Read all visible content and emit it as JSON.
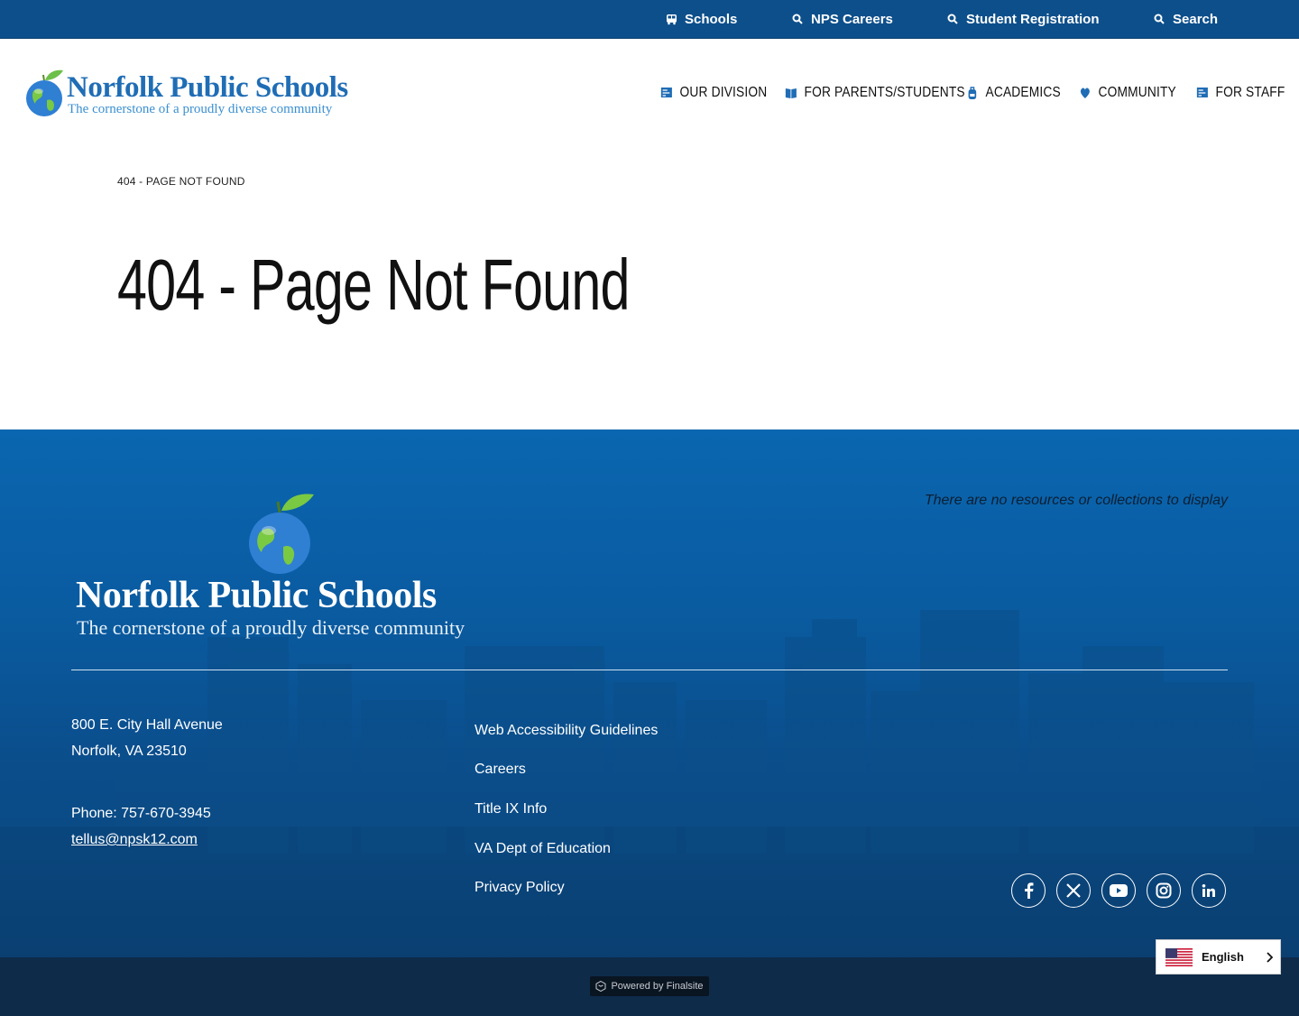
{
  "utility_nav": {
    "items": [
      {
        "label": "Schools",
        "icon": "school-bus-icon"
      },
      {
        "label": "NPS Careers",
        "icon": "search-icon"
      },
      {
        "label": "Student Registration",
        "icon": "search-icon"
      },
      {
        "label": "Search",
        "icon": "search-icon"
      }
    ]
  },
  "header": {
    "logo_title": "Norfolk Public Schools",
    "logo_tagline": "The cornerstone of a proudly diverse community",
    "nav": [
      {
        "label": "OUR DIVISION",
        "icon": "map-board-icon"
      },
      {
        "label": "FOR PARENTS/STUDENTS",
        "icon": "book-icon"
      },
      {
        "label": "ACADEMICS",
        "icon": "backpack-icon"
      },
      {
        "label": "COMMUNITY",
        "icon": "heart-hands-icon"
      },
      {
        "label": "FOR STAFF",
        "icon": "map-board-icon"
      }
    ]
  },
  "main": {
    "breadcrumb": "404 - PAGE NOT FOUND",
    "title": "404 - Page Not Found"
  },
  "footer": {
    "logo_title": "Norfolk Public Schools",
    "logo_tagline": "The cornerstone of a proudly diverse community",
    "resources_message": "There are no resources or collections to display",
    "address_line1": "800 E. City Hall Avenue",
    "address_line2": "Norfolk, VA  23510",
    "phone": "Phone: 757-670-3945",
    "email": "tellus@npsk12.com",
    "links": [
      "Web Accessibility Guidelines",
      "Careers",
      "Title IX Info",
      "VA Dept of Education",
      "Privacy Policy"
    ],
    "social": [
      "facebook-icon",
      "x-icon",
      "youtube-icon",
      "instagram-icon",
      "linkedin-icon"
    ],
    "powered_by": "Powered by Finalsite"
  },
  "language": {
    "selected": "English"
  },
  "colors": {
    "utility_bar": "#0d4f8b",
    "brand_blue": "#1f6db5",
    "footer_blue": "#0a5ba0",
    "bottom_bar": "#0e2b4a"
  }
}
